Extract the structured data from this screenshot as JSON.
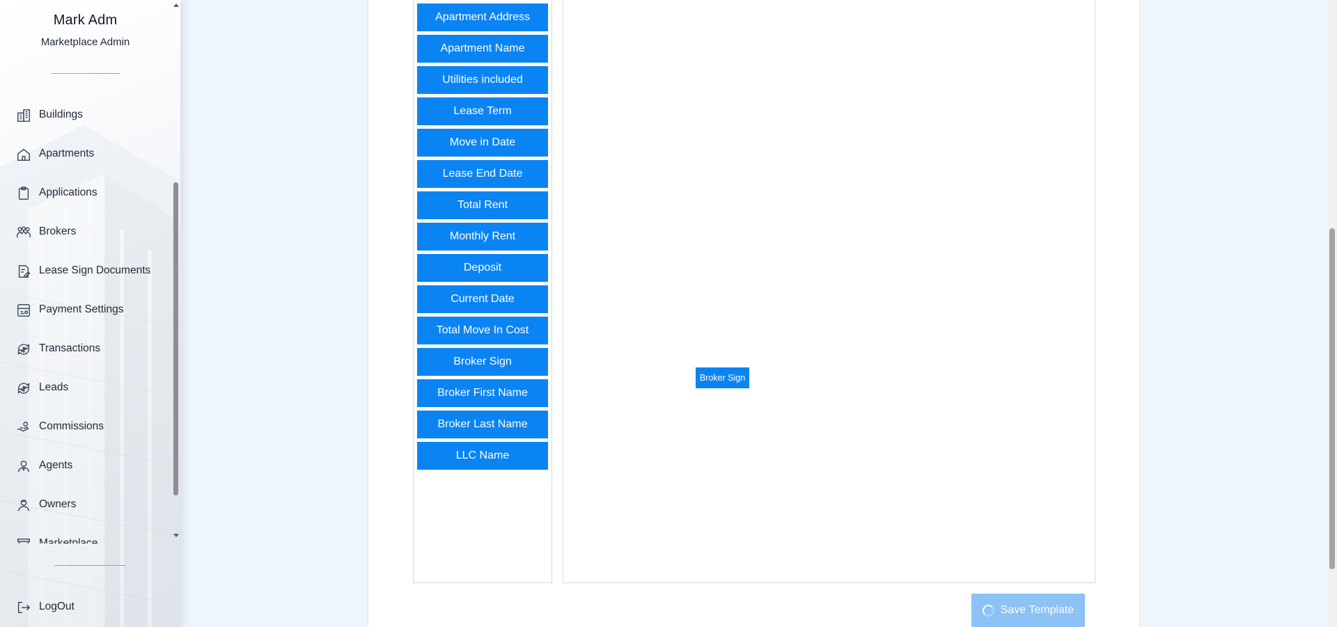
{
  "user": {
    "name": "Mark Adm",
    "role": "Marketplace Admin"
  },
  "nav": {
    "items": [
      {
        "label": "Buildings",
        "icon": "buildings-icon"
      },
      {
        "label": "Apartments",
        "icon": "home-icon"
      },
      {
        "label": "Applications",
        "icon": "clipboard-icon"
      },
      {
        "label": "Brokers",
        "icon": "brokers-icon"
      },
      {
        "label": "Lease Sign Documents",
        "icon": "document-sign-icon"
      },
      {
        "label": "Payment Settings",
        "icon": "payment-settings-icon"
      },
      {
        "label": "Transactions",
        "icon": "transactions-icon"
      },
      {
        "label": "Leads",
        "icon": "leads-icon"
      },
      {
        "label": "Commissions",
        "icon": "commission-hand-icon"
      },
      {
        "label": "Agents",
        "icon": "agent-icon"
      },
      {
        "label": "Owners",
        "icon": "owner-icon"
      },
      {
        "label": "Marketplace",
        "icon": "marketplace-icon"
      }
    ],
    "logout_label": "LogOut"
  },
  "template_editor": {
    "fields": [
      "Apartment Address",
      "Apartment Name",
      "Utilities included",
      "Lease Term",
      "Move in Date",
      "Lease End Date",
      "Total Rent",
      "Monthly Rent",
      "Deposit",
      "Current Date",
      "Total Move In Cost",
      "Broker Sign",
      "Broker First Name",
      "Broker Last Name",
      "LLC Name"
    ],
    "placed_fields": [
      {
        "label": "Broker Sign"
      }
    ],
    "save_label": "Save Template",
    "save_state": "loading"
  },
  "colors": {
    "accent": "#0b84f3",
    "accent_disabled": "#8cc2f6",
    "page_bg": "#eef5fc"
  }
}
